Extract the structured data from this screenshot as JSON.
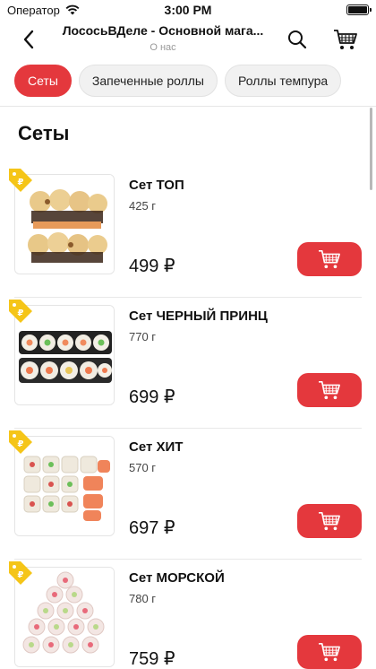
{
  "status_bar": {
    "carrier": "Оператор",
    "time": "3:00 PM"
  },
  "nav": {
    "title": "ЛососьВДеле - Основной мага...",
    "subtitle": "О нас"
  },
  "categories": [
    {
      "label": "Сеты",
      "active": true
    },
    {
      "label": "Запеченные роллы",
      "active": false
    },
    {
      "label": "Роллы темпура",
      "active": false
    }
  ],
  "section": {
    "title": "Сеты"
  },
  "products": [
    {
      "name": "Сет ТОП",
      "weight": "425 г",
      "price": "499 ₽",
      "icon": "baked-rolls-set"
    },
    {
      "name": "Сет ЧЕРНЫЙ ПРИНЦ",
      "weight": "770 г",
      "price": "699 ₽",
      "icon": "maki-rolls-set"
    },
    {
      "name": "Сет ХИТ",
      "weight": "570 г",
      "price": "697 ₽",
      "icon": "salmon-rolls-set"
    },
    {
      "name": "Сет МОРСКОЙ",
      "weight": "780 г",
      "price": "759 ₽",
      "icon": "seafood-rolls-set"
    }
  ],
  "colors": {
    "accent": "#e4383d",
    "badge": "#f5c518"
  }
}
